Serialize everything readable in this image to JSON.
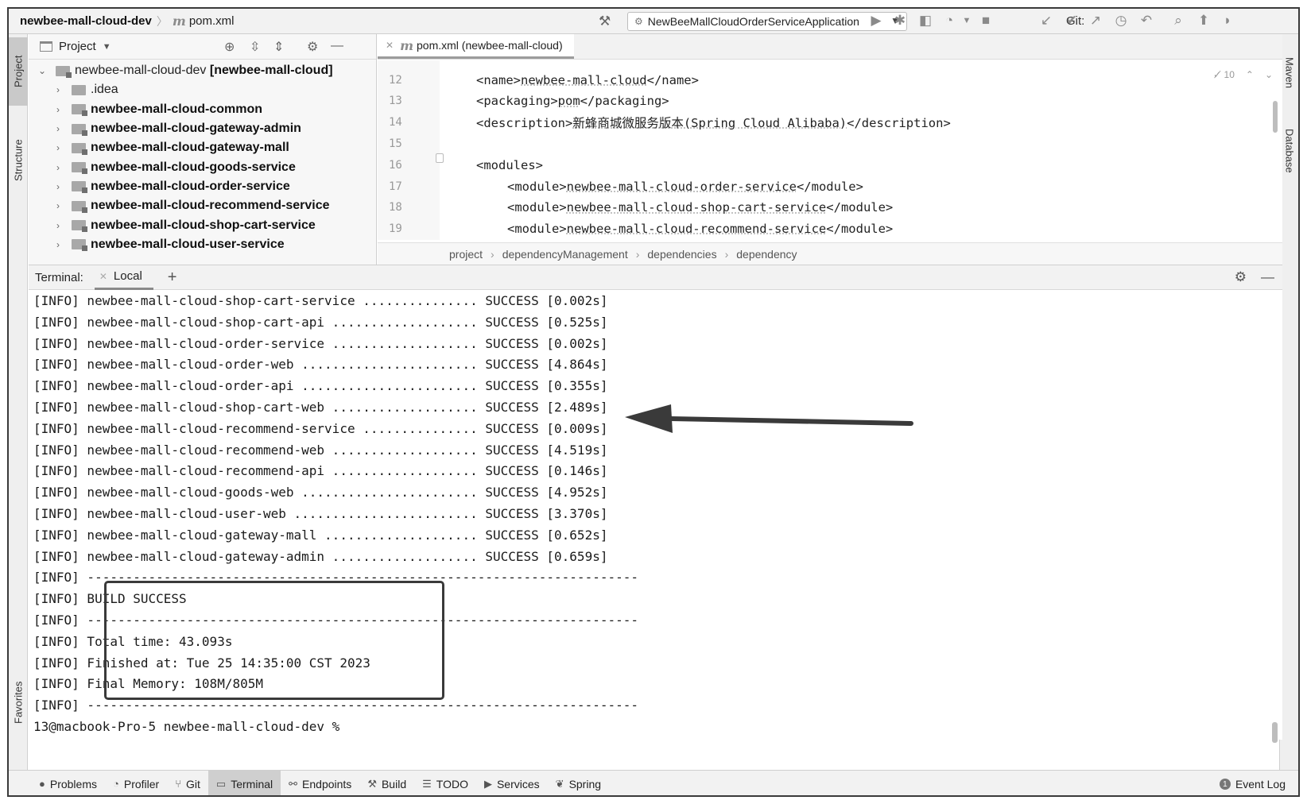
{
  "topbar": {
    "project": "newbee-mall-cloud-dev",
    "file": "pom.xml",
    "run_config": "NewBeeMallCloudOrderServiceApplication",
    "git_label": "Git:"
  },
  "left_strip": {
    "project_tab": "Project",
    "structure_tab": "Structure",
    "favorites_tab": "Favorites"
  },
  "right_strip": {
    "maven_tab": "Maven",
    "database_tab": "Database"
  },
  "project_panel": {
    "title": "Project",
    "root": {
      "name": "newbee-mall-cloud-dev",
      "module": "[newbee-mall-cloud]"
    },
    "items": [
      {
        "label": ".idea",
        "bold": false
      },
      {
        "label": "newbee-mall-cloud-common",
        "bold": true
      },
      {
        "label": "newbee-mall-cloud-gateway-admin",
        "bold": true
      },
      {
        "label": "newbee-mall-cloud-gateway-mall",
        "bold": true
      },
      {
        "label": "newbee-mall-cloud-goods-service",
        "bold": true
      },
      {
        "label": "newbee-mall-cloud-order-service",
        "bold": true
      },
      {
        "label": "newbee-mall-cloud-recommend-service",
        "bold": true
      },
      {
        "label": "newbee-mall-cloud-shop-cart-service",
        "bold": true
      },
      {
        "label": "newbee-mall-cloud-user-service",
        "bold": true
      }
    ]
  },
  "editor": {
    "tab_label": "pom.xml (newbee-mall-cloud)",
    "warning_count": "10",
    "lines": [
      {
        "num": "12",
        "indent": 1,
        "open": "<name>",
        "value": "newbee-mall-cloud",
        "close": "</name>"
      },
      {
        "num": "13",
        "indent": 1,
        "open": "<packaging>",
        "value": "pom",
        "close": "</packaging>"
      },
      {
        "num": "14",
        "indent": 1,
        "open": "<description>",
        "value": "新蜂商城微服务版本(Spring Cloud Alibaba)",
        "close": "</description>"
      },
      {
        "num": "15",
        "indent": 0,
        "open": "",
        "value": "",
        "close": ""
      },
      {
        "num": "16",
        "indent": 1,
        "open": "<modules>",
        "value": "",
        "close": ""
      },
      {
        "num": "17",
        "indent": 2,
        "open": "<module>",
        "value": "newbee-mall-cloud-order-service",
        "close": "</module>"
      },
      {
        "num": "18",
        "indent": 2,
        "open": "<module>",
        "value": "newbee-mall-cloud-shop-cart-service",
        "close": "</module>"
      },
      {
        "num": "19",
        "indent": 2,
        "open": "<module>",
        "value": "newbee-mall-cloud-recommend-service",
        "close": "</module>"
      }
    ],
    "breadcrumbs": [
      "project",
      "dependencyManagement",
      "dependencies",
      "dependency"
    ]
  },
  "terminal": {
    "title": "Terminal:",
    "tab": "Local",
    "lines": [
      "[INFO] newbee-mall-cloud-shop-cart-service ............... SUCCESS [0.002s]",
      "[INFO] newbee-mall-cloud-shop-cart-api ................... SUCCESS [0.525s]",
      "[INFO] newbee-mall-cloud-order-service ................... SUCCESS [0.002s]",
      "[INFO] newbee-mall-cloud-order-web ....................... SUCCESS [4.864s]",
      "[INFO] newbee-mall-cloud-order-api ....................... SUCCESS [0.355s]",
      "[INFO] newbee-mall-cloud-shop-cart-web ................... SUCCESS [2.489s]",
      "[INFO] newbee-mall-cloud-recommend-service ............... SUCCESS [0.009s]",
      "[INFO] newbee-mall-cloud-recommend-web ................... SUCCESS [4.519s]",
      "[INFO] newbee-mall-cloud-recommend-api ................... SUCCESS [0.146s]",
      "[INFO] newbee-mall-cloud-goods-web ....................... SUCCESS [4.952s]",
      "[INFO] newbee-mall-cloud-user-web ........................ SUCCESS [3.370s]",
      "[INFO] newbee-mall-cloud-gateway-mall .................... SUCCESS [0.652s]",
      "[INFO] newbee-mall-cloud-gateway-admin ................... SUCCESS [0.659s]",
      "[INFO] ------------------------------------------------------------------------",
      "[INFO] BUILD SUCCESS",
      "[INFO] ------------------------------------------------------------------------",
      "[INFO] Total time: 43.093s",
      "[INFO] Finished at: Tue 25 14:35:00 CST 2023",
      "[INFO] Final Memory: 108M/805M",
      "[INFO] ------------------------------------------------------------------------",
      "13@macbook-Pro-5 newbee-mall-cloud-dev %"
    ]
  },
  "bottombar": {
    "items": [
      {
        "label": "Problems",
        "icon": "problems-icon"
      },
      {
        "label": "Profiler",
        "icon": "profiler-icon"
      },
      {
        "label": "Git",
        "icon": "git-icon"
      },
      {
        "label": "Terminal",
        "icon": "terminal-icon"
      },
      {
        "label": "Endpoints",
        "icon": "endpoints-icon"
      },
      {
        "label": "Build",
        "icon": "hammer-icon"
      },
      {
        "label": "TODO",
        "icon": "list-icon"
      },
      {
        "label": "Services",
        "icon": "services-icon"
      },
      {
        "label": "Spring",
        "icon": "spring-icon"
      }
    ],
    "active": "Terminal",
    "event_log": "Event Log",
    "event_log_count": "1"
  },
  "colors": {
    "frame": "#3a3a3a",
    "toolbar_bg": "#f2f2f2",
    "annotation": "#3a3a3a"
  }
}
